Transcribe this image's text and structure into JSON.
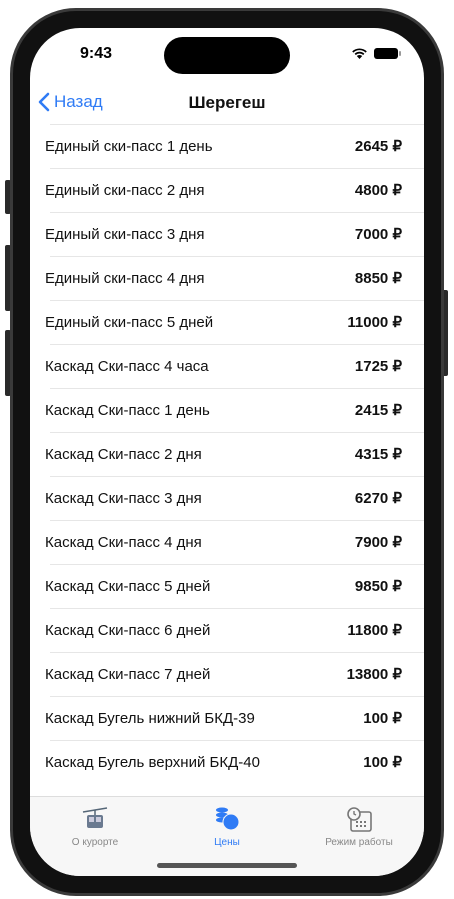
{
  "status": {
    "time": "9:43"
  },
  "nav": {
    "back_label": "Назад",
    "title": "Шерегеш"
  },
  "prices": [
    {
      "name": "Единый ски-пасс 1 день",
      "price": "2645 ₽"
    },
    {
      "name": "Единый ски-пасс 2 дня",
      "price": "4800 ₽"
    },
    {
      "name": "Единый ски-пасс 3 дня",
      "price": "7000 ₽"
    },
    {
      "name": "Единый ски-пасс 4 дня",
      "price": "8850 ₽"
    },
    {
      "name": "Единый ски-пасс 5 дней",
      "price": "11000 ₽"
    },
    {
      "name": "Каскад Ски-пасс 4 часа",
      "price": "1725 ₽"
    },
    {
      "name": "Каскад Ски-пасс 1 день",
      "price": "2415 ₽"
    },
    {
      "name": "Каскад Ски-пасс 2 дня",
      "price": "4315 ₽"
    },
    {
      "name": "Каскад Ски-пасс 3 дня",
      "price": "6270 ₽"
    },
    {
      "name": "Каскад Ски-пасс 4 дня",
      "price": "7900 ₽"
    },
    {
      "name": "Каскад Ски-пасс 5 дней",
      "price": "9850 ₽"
    },
    {
      "name": "Каскад Ски-пасс 6 дней",
      "price": "11800 ₽"
    },
    {
      "name": "Каскад Ски-пасс 7 дней",
      "price": "13800 ₽"
    },
    {
      "name": "Каскад Бугель нижний БКД-39",
      "price": "100 ₽"
    },
    {
      "name": "Каскад Бугель верхний БКД-40",
      "price": "100 ₽"
    }
  ],
  "tabs": [
    {
      "label": "О курорте",
      "icon": "cable-car-icon"
    },
    {
      "label": "Цены",
      "icon": "coins-icon",
      "active": true
    },
    {
      "label": "Режим работы",
      "icon": "clock-calendar-icon"
    }
  ],
  "colors": {
    "accent": "#2f7bf5"
  }
}
